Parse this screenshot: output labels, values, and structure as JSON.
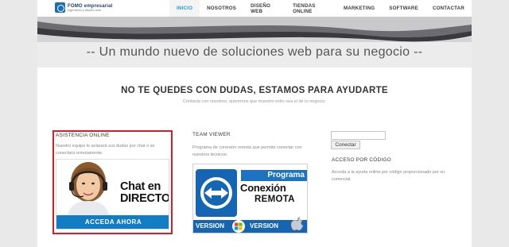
{
  "header": {
    "logo_name": "FOMO empresarial",
    "logo_tagline": "ingeniería y diseño web",
    "nav": [
      {
        "label": "INICIO",
        "active": true
      },
      {
        "label": "NOSOTROS"
      },
      {
        "label": "DISEÑO WEB"
      },
      {
        "label": "TIENDAS ONLINE"
      },
      {
        "label": "MARKETING"
      },
      {
        "label": "SOFTWARE"
      },
      {
        "label": "CONTACTAR"
      }
    ]
  },
  "hero": {
    "slogan": "-- Un mundo nuevo de soluciones web para su negocio --"
  },
  "main": {
    "heading": "NO TE QUEDES CON DUDAS, ESTAMOS PARA AYUDARTE",
    "subheading": "Contacta con nosotros, queremos que muestro exito sea el de tu negocio."
  },
  "columns": {
    "asistencia": {
      "title": "ASISTENCIA ONLINE",
      "text": "Nuestro equipo le aclarará sus dudas por chat o se conectará remotamente.",
      "banner_title": "Chat en DIRECTO",
      "banner_cta": "ACCEDA AHORA"
    },
    "teamviewer": {
      "title": "TEAM VIEWER",
      "text": "Programa de conexión remota que permite conectar con nuestros técnicos.",
      "banner_programa": "Programa",
      "banner_conexion": "Conexión",
      "banner_remota": "REMOTA",
      "version_1": "VERSION",
      "version_2": "VERSION"
    },
    "codigo": {
      "input_value": "",
      "button_label": "Conectar",
      "title": "ACCESO POR CÓDIGO",
      "text": "Acceda a la ayuda online por código proporcionado por su comercial."
    }
  },
  "colors": {
    "accent_blue": "#1e9bd7",
    "highlight_red": "#d61e2a",
    "banner_blue": "#127cc4"
  }
}
